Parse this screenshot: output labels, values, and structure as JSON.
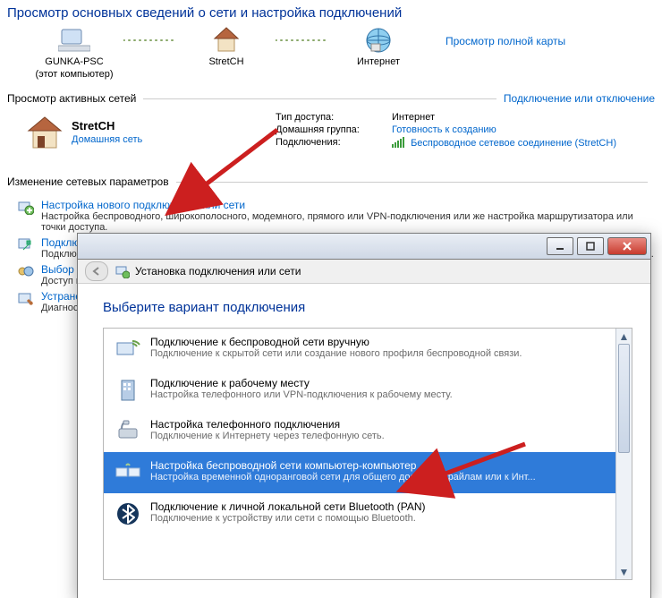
{
  "title": "Просмотр основных сведений о сети и настройка подключений",
  "map": {
    "node1": {
      "label": "GUNKA-PSC",
      "sub": "(этот компьютер)"
    },
    "node2": {
      "label": "StretCH"
    },
    "node3": {
      "label": "Интернет"
    },
    "full_map_link": "Просмотр полной карты"
  },
  "active_nets": {
    "heading": "Просмотр активных сетей",
    "right_link": "Подключение или отключение",
    "net_name": "StretCH",
    "net_kind": "Домашняя сеть",
    "rows": {
      "access_k": "Тип доступа:",
      "access_v": "Интернет",
      "hg_k": "Домашняя группа:",
      "hg_v": "Готовность к созданию",
      "conn_k": "Подключения:",
      "conn_v": "Беспроводное сетевое соединение (StretCH)"
    }
  },
  "change_heading": "Изменение сетевых параметров",
  "tasks": [
    {
      "link": "Настройка нового подключения или сети",
      "desc": "Настройка беспроводного, широкополосного, модемного, прямого или VPN-подключения или же настройка маршрутизатора или точки доступа."
    },
    {
      "link": "Подключиться к сети",
      "desc": "Подключение или повторное подключение к беспроводному, проводному, модемному сетевому соединению или подключение к VPN."
    },
    {
      "link": "Выбор домашней группы и параметров общего доступа",
      "desc": "Доступ к файлам и принтерам, расположенным на других сетевых компьютерах, или изменение параметров общего доступа."
    },
    {
      "link": "Устранение неполадок",
      "desc": "Диагностика и исправление сетевых проблем или получение сведений об исправлении."
    }
  ],
  "dialog": {
    "win_title": "Установка подключения или сети",
    "heading": "Выберите вариант подключения",
    "options": [
      {
        "t": "Подключение к беспроводной сети вручную",
        "d": "Подключение к скрытой сети или создание нового профиля беспроводной связи."
      },
      {
        "t": "Подключение к рабочему месту",
        "d": "Настройка телефонного или VPN-подключения к рабочему месту."
      },
      {
        "t": "Настройка телефонного подключения",
        "d": "Подключение к Интернету через телефонную сеть."
      },
      {
        "t": "Настройка беспроводной сети компьютер-компьютер",
        "d": "Настройка временной одноранговой сети для общего доступа к файлам или к Инт..."
      },
      {
        "t": "Подключение к личной локальной сети Bluetooth (PAN)",
        "d": "Подключение к устройству или сети с помощью Bluetooth."
      }
    ]
  }
}
